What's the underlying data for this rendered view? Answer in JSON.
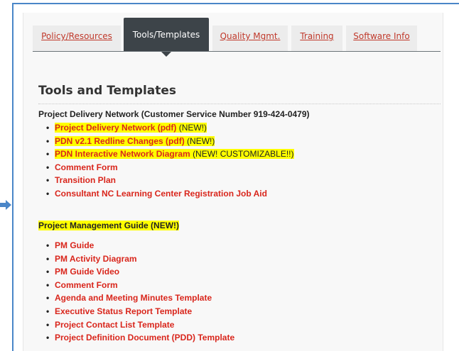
{
  "tabs": [
    {
      "label": "Policy/Resources",
      "active": false
    },
    {
      "label": "Tools/Templates",
      "active": true
    },
    {
      "label": "Quality Mgmt.",
      "active": false
    },
    {
      "label": "Training",
      "active": false
    },
    {
      "label": "Software Info",
      "active": false
    }
  ],
  "page_title": "Tools and Templates",
  "pdn": {
    "title": "Project Delivery Network (Customer Service Number 919-424-0479)",
    "items": [
      {
        "label": "Project Delivery Network (pdf)",
        "note": " (NEW!)"
      },
      {
        "label": "PDN v2.1 Redline Changes (pdf)",
        "note": " (NEW!)"
      },
      {
        "label": "PDN Interactive Network Diagram ",
        "note": " (NEW! CUSTOMIZABLE!!)"
      },
      {
        "label": "Comment Form"
      },
      {
        "label": "Transition Plan"
      },
      {
        "label": "Consultant NC Learning Center Registration Job Aid"
      }
    ]
  },
  "pm": {
    "title": "Project Management Guide (NEW!)",
    "items": [
      {
        "label": "PM Guide"
      },
      {
        "label": "PM Activity Diagram"
      },
      {
        "label": "PM Guide Video"
      },
      {
        "label": "Comment Form"
      },
      {
        "label": "Agenda and Meeting Minutes Template"
      },
      {
        "label": "Executive Status Report Template"
      },
      {
        "label": "Project Contact List Template"
      },
      {
        "label": "Project Definition Document (PDD) Template"
      }
    ]
  },
  "colors": {
    "link": "#d9261c",
    "highlight": "#ffff00",
    "active_tab": "#3d4449",
    "frame": "#4a86c8"
  }
}
